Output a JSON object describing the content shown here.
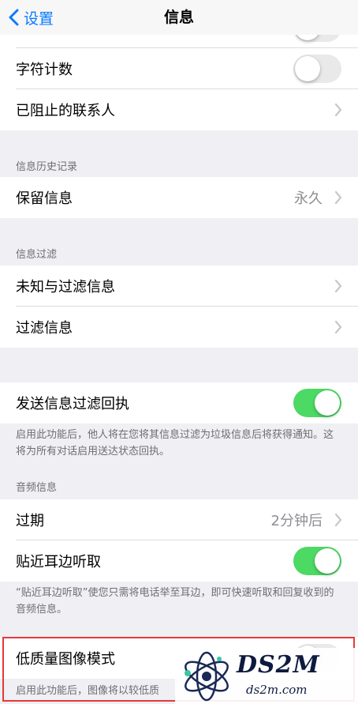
{
  "nav": {
    "back_label": "设置",
    "title": "信息"
  },
  "rows": {
    "char_count": "字符计数",
    "blocked": "已阻止的联系人",
    "keep_messages": "保留信息",
    "keep_value": "永久",
    "unknown_filter": "未知与过滤信息",
    "filter_messages": "过滤信息",
    "send_filter_receipt": "发送信息过滤回执",
    "expire": "过期",
    "expire_value": "2分钟后",
    "raise_to_listen": "贴近耳边听取",
    "low_quality": "低质量图像模式"
  },
  "sections": {
    "history": "信息历史记录",
    "filtering": "信息过滤",
    "audio": "音频信息"
  },
  "footers": {
    "filter_receipt": "启用此功能后，他人将在您将其信息过滤为垃圾信息后将获得通知。这将为所有对话启用送达状态回执。",
    "raise_to_listen": "“贴近耳边听取”使您只需将电话举至耳边，即可快速听取和回复收到的音频信息。",
    "low_quality": "启用此功能后，图像将以较低质"
  },
  "toggles": {
    "char_count": false,
    "send_filter_receipt": true,
    "raise_to_listen": true,
    "low_quality": false
  },
  "colors": {
    "accent": "#0a7aff",
    "toggle_on": "#4cd964",
    "highlight": "#e33a3a"
  },
  "watermark": {
    "brand": "DS2M",
    "site": "ds2m.com"
  }
}
